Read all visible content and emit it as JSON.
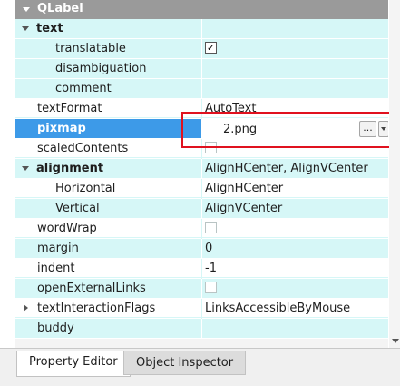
{
  "header": {
    "title": "QLabel"
  },
  "rows": [
    {
      "name": "text",
      "value": ""
    },
    {
      "name": "translatable",
      "value": ""
    },
    {
      "name": "disambiguation",
      "value": ""
    },
    {
      "name": "comment",
      "value": ""
    },
    {
      "name": "textFormat",
      "value": "AutoText"
    },
    {
      "name": "pixmap",
      "value": "2.png"
    },
    {
      "name": "scaledContents",
      "value": ""
    },
    {
      "name": "alignment",
      "value": "AlignHCenter, AlignVCenter"
    },
    {
      "name": "Horizontal",
      "value": "AlignHCenter"
    },
    {
      "name": "Vertical",
      "value": "AlignVCenter"
    },
    {
      "name": "wordWrap",
      "value": ""
    },
    {
      "name": "margin",
      "value": "0"
    },
    {
      "name": "indent",
      "value": "-1"
    },
    {
      "name": "openExternalLinks",
      "value": ""
    },
    {
      "name": "textInteractionFlags",
      "value": "LinksAccessibleByMouse"
    },
    {
      "name": "buddy",
      "value": ""
    }
  ],
  "pixmap_buttons": {
    "more": "...",
    "reset": "↶"
  },
  "checkboxes": {
    "translatable": true,
    "scaledContents": false,
    "wordWrap": false,
    "openExternalLinks": false
  },
  "tabs": {
    "property_editor": "Property Editor",
    "object_inspector": "Object Inspector"
  },
  "colors": {
    "row_cyan": "#d6f7f7",
    "selected": "#3d9ae8",
    "header": "#9a9a9a",
    "highlight": "#e0121f"
  }
}
